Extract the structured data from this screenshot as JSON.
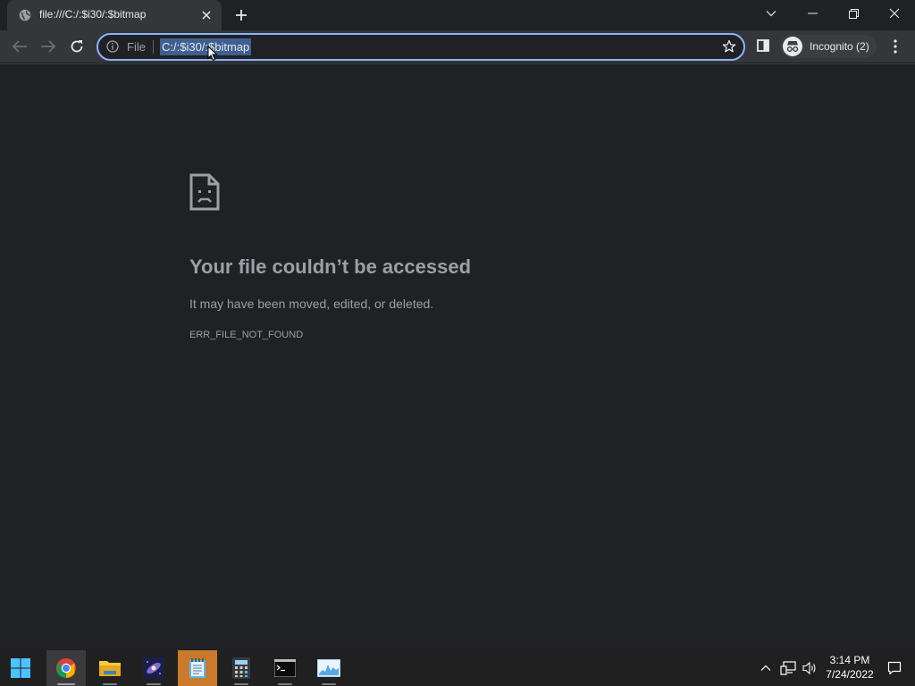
{
  "browser": {
    "tab_title": "file:///C:/:$i30/:$bitmap",
    "scheme_label": "File",
    "url": "C:/:$i30/:$bitmap",
    "profile_label": "Incognito (2)",
    "accent_color": "#8ab4f8"
  },
  "error_page": {
    "title": "Your file couldn’t be accessed",
    "description": "It may have been moved, edited, or deleted.",
    "code": "ERR_FILE_NOT_FOUND"
  },
  "taskbar": {
    "apps": [
      "windows-start",
      "chrome",
      "file-explorer",
      "space-wallpaper-app",
      "notepad",
      "calculator",
      "command-prompt",
      "resource-monitor"
    ],
    "time": "3:14 PM",
    "date": "7/24/2022"
  },
  "icons": [
    "globe-icon",
    "close-icon",
    "plus-icon",
    "chevron-down-icon",
    "minimize-icon",
    "restore-icon",
    "back-icon",
    "forward-icon",
    "reload-icon",
    "info-icon",
    "star-icon",
    "side-panel-icon",
    "incognito-icon",
    "more-menu-icon",
    "sad-file-icon"
  ]
}
